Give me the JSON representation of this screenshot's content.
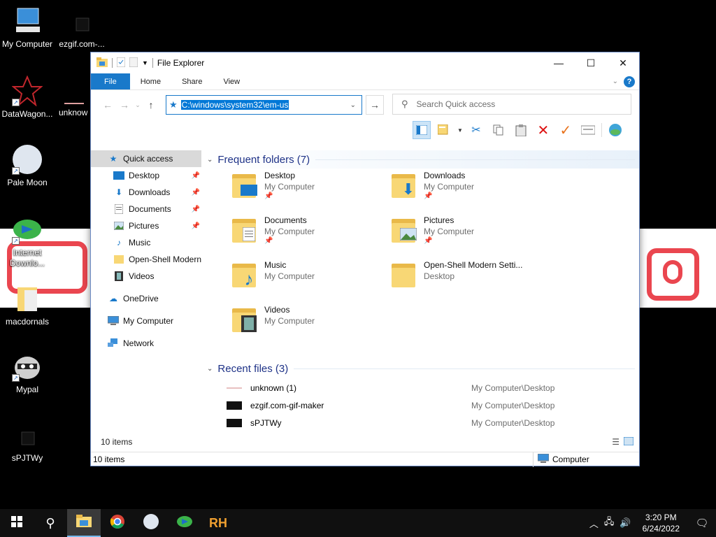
{
  "colors": {
    "accent": "#1979ca",
    "folder": "#f8d775",
    "folder_back": "#e9b949",
    "section_heading": "#1e3287",
    "scribble": "#e8323c"
  },
  "desktop": {
    "icons": [
      {
        "label": "My Computer",
        "icon": "computer-icon"
      },
      {
        "label": "ezgif.com-...",
        "icon": "file-icon"
      },
      {
        "label": "DataWagon...",
        "icon": "datawagon-icon"
      },
      {
        "label": "unknow",
        "icon": "file-icon"
      },
      {
        "label": "Pale Moon",
        "icon": "pale-moon-icon"
      },
      {
        "label": "Internet Downlo...",
        "icon": "idm-icon"
      },
      {
        "label": "macdornals",
        "icon": "folder-icon"
      },
      {
        "label": "Mypal",
        "icon": "mypal-icon"
      },
      {
        "label": "sPJTWy",
        "icon": "file-icon"
      }
    ]
  },
  "window": {
    "title": "File Explorer",
    "ribbon_tabs": [
      "File",
      "Home",
      "Share",
      "View"
    ],
    "help_label": "?",
    "address": "C:\\windows\\system32\\em-us",
    "search_placeholder": "Search Quick access",
    "sidebar": [
      {
        "label": "Quick access",
        "icon": "star-icon",
        "selected": true
      },
      {
        "label": "Desktop",
        "icon": "desktop-icon",
        "pinned": true
      },
      {
        "label": "Downloads",
        "icon": "download-icon",
        "pinned": true
      },
      {
        "label": "Documents",
        "icon": "documents-icon",
        "pinned": true
      },
      {
        "label": "Pictures",
        "icon": "pictures-icon",
        "pinned": true
      },
      {
        "label": "Music",
        "icon": "music-icon"
      },
      {
        "label": "Open-Shell Modern",
        "icon": "folder-icon"
      },
      {
        "label": "Videos",
        "icon": "videos-icon"
      },
      {
        "label": "OneDrive",
        "icon": "onedrive-icon"
      },
      {
        "label": "My Computer",
        "icon": "computer-icon"
      },
      {
        "label": "Network",
        "icon": "network-icon"
      }
    ],
    "frequent": {
      "heading": "Frequent folders (7)",
      "folders": [
        {
          "name": "Desktop",
          "location": "My Computer",
          "pinned": true
        },
        {
          "name": "Downloads",
          "location": "My Computer",
          "pinned": true
        },
        {
          "name": "Documents",
          "location": "My Computer",
          "pinned": true
        },
        {
          "name": "Pictures",
          "location": "My Computer",
          "pinned": true
        },
        {
          "name": "Music",
          "location": "My Computer"
        },
        {
          "name": "Open-Shell Modern Setti...",
          "location": "Desktop"
        },
        {
          "name": "Videos",
          "location": "My Computer"
        }
      ]
    },
    "recent": {
      "heading": "Recent files (3)",
      "files": [
        {
          "name": "unknown (1)",
          "path": "My Computer\\Desktop"
        },
        {
          "name": "ezgif.com-gif-maker",
          "path": "My Computer\\Desktop"
        },
        {
          "name": "sPJTWy",
          "path": "My Computer\\Desktop"
        }
      ]
    },
    "item_count": "10 items",
    "status_count": "10 items",
    "status_location": "Computer"
  },
  "taskbar": {
    "apps": [
      "file-explorer-icon",
      "chrome-icon",
      "pale-moon-icon",
      "idm-icon",
      "rh-icon"
    ],
    "rh_label": "RH",
    "time": "3:20 PM",
    "date": "6/24/2022"
  }
}
